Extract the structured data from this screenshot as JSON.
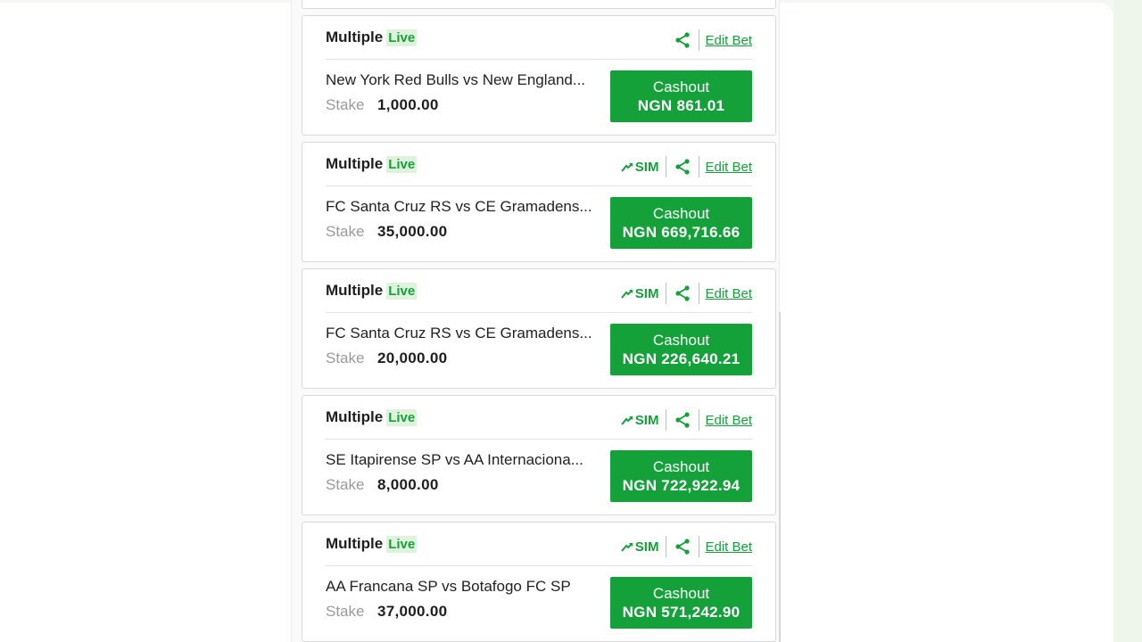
{
  "bets": [
    {
      "type_label": "Multiple",
      "live_label": "Live",
      "has_sim": false,
      "sim_label": "",
      "edit_label": "Edit Bet",
      "match": "New York Red Bulls vs New England...",
      "stake_label": "Stake",
      "stake_value": "1,000.00",
      "cashout_label": "Cashout",
      "cashout_amount": "NGN 861.01"
    },
    {
      "type_label": "Multiple",
      "live_label": "Live",
      "has_sim": true,
      "sim_label": "SIM",
      "edit_label": "Edit Bet",
      "match": "FC Santa Cruz RS vs CE Gramadens...",
      "stake_label": "Stake",
      "stake_value": "35,000.00",
      "cashout_label": "Cashout",
      "cashout_amount": "NGN 669,716.66"
    },
    {
      "type_label": "Multiple",
      "live_label": "Live",
      "has_sim": true,
      "sim_label": "SIM",
      "edit_label": "Edit Bet",
      "match": "FC Santa Cruz RS vs CE Gramadens...",
      "stake_label": "Stake",
      "stake_value": "20,000.00",
      "cashout_label": "Cashout",
      "cashout_amount": "NGN 226,640.21"
    },
    {
      "type_label": "Multiple",
      "live_label": "Live",
      "has_sim": true,
      "sim_label": "SIM",
      "edit_label": "Edit Bet",
      "match": "SE Itapirense SP vs AA Internaciona...",
      "stake_label": "Stake",
      "stake_value": "8,000.00",
      "cashout_label": "Cashout",
      "cashout_amount": "NGN 722,922.94"
    },
    {
      "type_label": "Multiple",
      "live_label": "Live",
      "has_sim": true,
      "sim_label": "SIM",
      "edit_label": "Edit Bet",
      "match": "AA Francana SP vs Botafogo FC SP",
      "stake_label": "Stake",
      "stake_value": "37,000.00",
      "cashout_label": "Cashout",
      "cashout_amount": "NGN 571,242.90"
    }
  ],
  "colors": {
    "accent": "#15a13a",
    "live_bg": "#dff3dc"
  },
  "icons": {
    "share": "share-icon",
    "sim": "sim-arrow-icon"
  }
}
